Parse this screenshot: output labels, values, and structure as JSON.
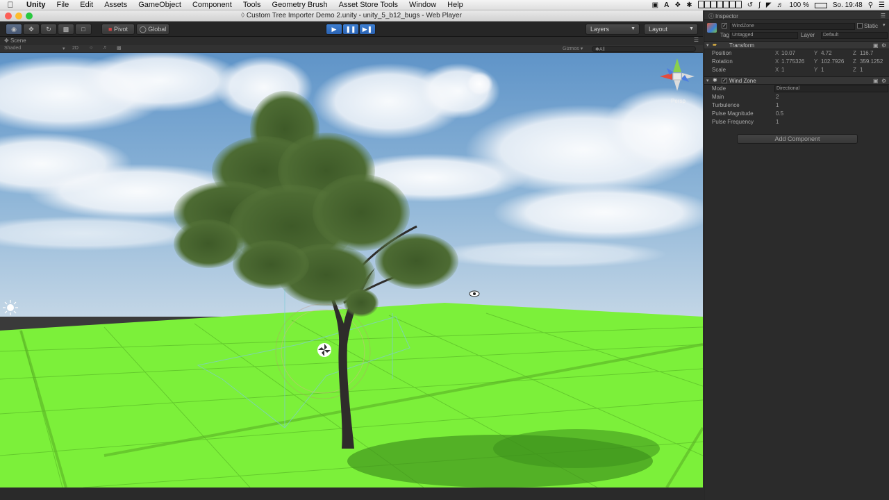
{
  "menubar": {
    "apple": "",
    "items": [
      "Unity",
      "File",
      "Edit",
      "Assets",
      "GameObject",
      "Component",
      "Tools",
      "Geometry Brush",
      "Asset Store Tools",
      "Window",
      "Help"
    ],
    "battery": "100 %",
    "clock": "So. 19:48"
  },
  "window": {
    "title": "Custom Tree Importer Demo 2.unity - unity_5_b12_bugs - Web Player"
  },
  "toolbar": {
    "pivot_label": "Pivot",
    "global_label": "Global",
    "layers_label": "Layers",
    "layout_label": "Layout"
  },
  "scene": {
    "tab_label": "Scene",
    "shading_mode": "Shaded",
    "mode_2d": "2D",
    "gizmos_label": "Gizmos",
    "search_placeholder": "✱All",
    "persp_label": "Persp"
  },
  "inspector": {
    "tab_label": "Inspector",
    "object_name": "WindZone",
    "static_label": "Static",
    "tag_label": "Tag",
    "tag_value": "Untagged",
    "layer_label": "Layer",
    "layer_value": "Default",
    "transform": {
      "title": "Transform",
      "position_label": "Position",
      "rotation_label": "Rotation",
      "scale_label": "Scale",
      "x_label": "X",
      "y_label": "Y",
      "z_label": "Z",
      "position": {
        "x": "10.07",
        "y": "4.72",
        "z": "116.7"
      },
      "rotation": {
        "x": "1.775326",
        "y": "102.7926",
        "z": "359.1252"
      },
      "scale": {
        "x": "1",
        "y": "1",
        "z": "1"
      }
    },
    "wind_zone": {
      "title": "Wind Zone",
      "mode_label": "Mode",
      "mode_value": "Directional",
      "main_label": "Main",
      "main_value": "2",
      "turbulence_label": "Turbulence",
      "turbulence_value": "1",
      "pulse_magnitude_label": "Pulse Magnitude",
      "pulse_magnitude_value": "0.5",
      "pulse_frequency_label": "Pulse Frequency",
      "pulse_frequency_value": "1"
    },
    "add_component_label": "Add Component"
  },
  "colors": {
    "sky_top": "#5f94c8",
    "sky_bottom": "#b9d0e4",
    "ground": "#7cf03a",
    "play_active": "#3d7fd2",
    "panel_bg": "#2b2b2b"
  }
}
